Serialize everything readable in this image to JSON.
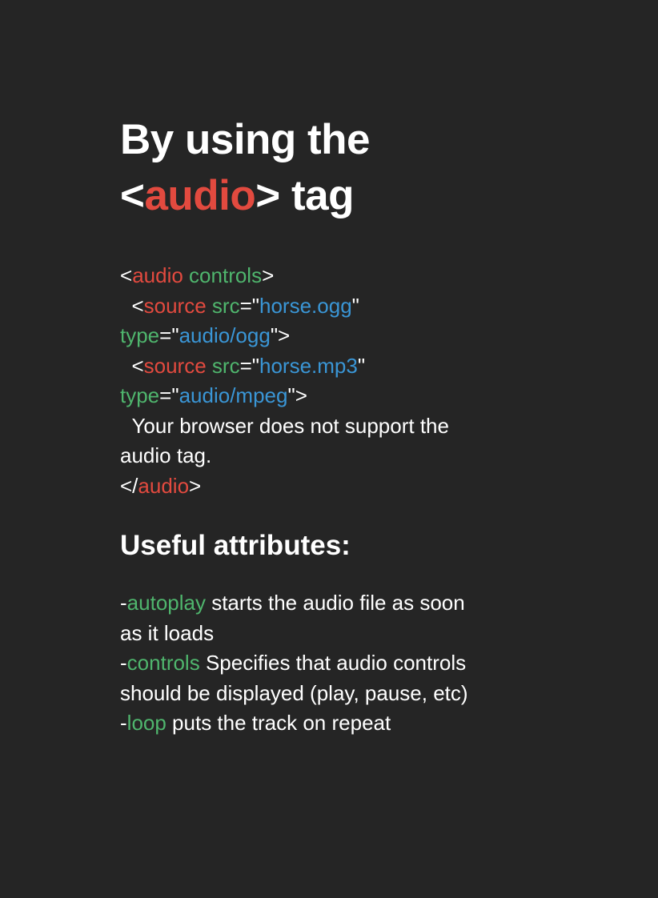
{
  "colors": {
    "background": "#252525",
    "text": "#ffffff",
    "tag": "#e24a3f",
    "attribute": "#4fb56d",
    "value": "#3a96d6"
  },
  "title": {
    "line1": "By using the",
    "open": "<",
    "tag": "audio",
    "close": ">",
    "suffix": " tag"
  },
  "code": [
    [
      {
        "text": "<",
        "c": "white"
      },
      {
        "text": "audio",
        "c": "red"
      },
      {
        "text": " ",
        "c": "white"
      },
      {
        "text": "controls",
        "c": "green"
      },
      {
        "text": ">",
        "c": "white"
      }
    ],
    [
      {
        "text": "  <",
        "c": "white"
      },
      {
        "text": "source",
        "c": "red"
      },
      {
        "text": " ",
        "c": "white"
      },
      {
        "text": "src",
        "c": "green"
      },
      {
        "text": "=\"",
        "c": "white"
      },
      {
        "text": "horse.ogg",
        "c": "blue"
      },
      {
        "text": "\"",
        "c": "white"
      }
    ],
    [
      {
        "text": "type",
        "c": "green"
      },
      {
        "text": "=\"",
        "c": "white"
      },
      {
        "text": "audio/ogg",
        "c": "blue"
      },
      {
        "text": "\">",
        "c": "white"
      }
    ],
    [
      {
        "text": "  <",
        "c": "white"
      },
      {
        "text": "source",
        "c": "red"
      },
      {
        "text": " ",
        "c": "white"
      },
      {
        "text": "src",
        "c": "green"
      },
      {
        "text": "=\"",
        "c": "white"
      },
      {
        "text": "horse.mp3",
        "c": "blue"
      },
      {
        "text": "\"",
        "c": "white"
      }
    ],
    [
      {
        "text": "type",
        "c": "green"
      },
      {
        "text": "=\"",
        "c": "white"
      },
      {
        "text": "audio/mpeg",
        "c": "blue"
      },
      {
        "text": "\">",
        "c": "white"
      }
    ],
    [
      {
        "text": "  Your browser does not support the",
        "c": "white"
      }
    ],
    [
      {
        "text": "audio tag.",
        "c": "white"
      }
    ],
    [
      {
        "text": "</",
        "c": "white"
      },
      {
        "text": "audio",
        "c": "red"
      },
      {
        "text": ">",
        "c": "white"
      }
    ]
  ],
  "attributes_heading": "Useful attributes:",
  "attributes": [
    {
      "dash": "-",
      "name": "autoplay",
      "lines": [
        " starts the audio file as soon",
        "as it loads"
      ]
    },
    {
      "dash": "-",
      "name": "controls",
      "lines": [
        " Specifies that audio controls",
        "should be displayed (play, pause, etc)"
      ]
    },
    {
      "dash": "-",
      "name": "loop",
      "lines": [
        " puts the track on repeat"
      ]
    }
  ]
}
